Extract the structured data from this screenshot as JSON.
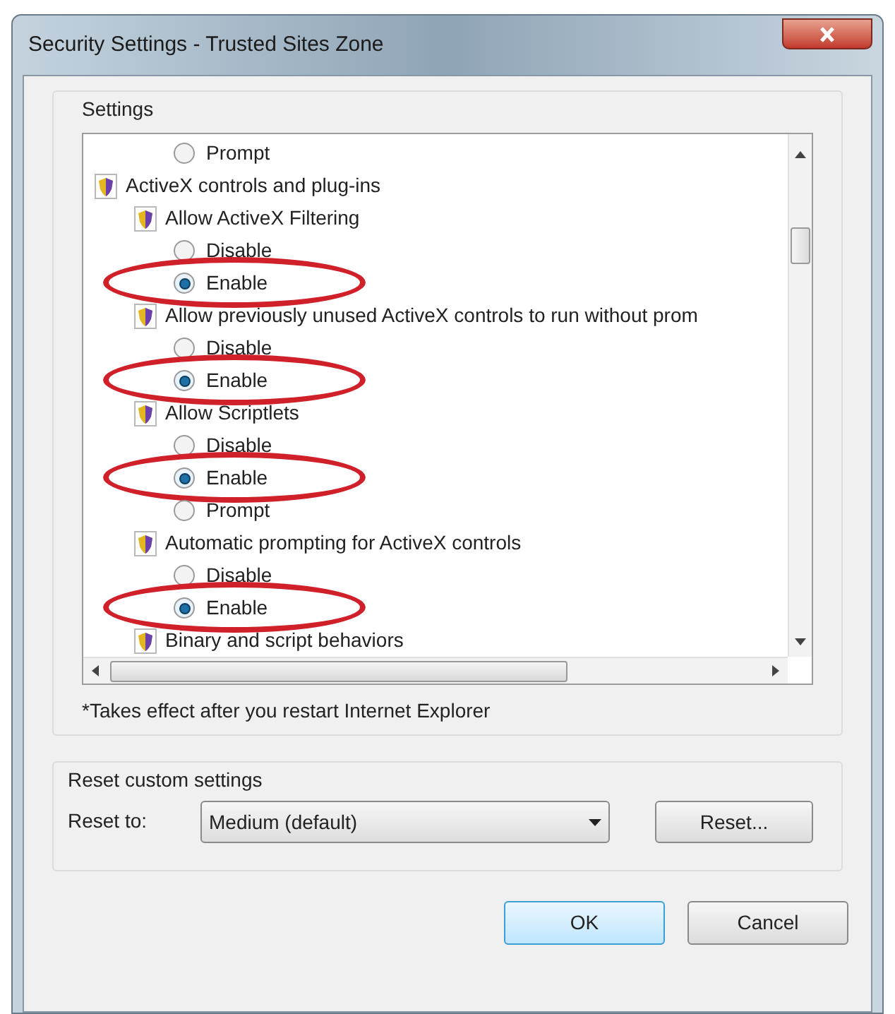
{
  "window": {
    "title": "Security Settings - Trusted Sites Zone"
  },
  "settings": {
    "label": "Settings",
    "items": [
      {
        "kind": "option",
        "label": "Prompt",
        "selected": false,
        "highlighted": false
      },
      {
        "kind": "category",
        "label": "ActiveX controls and plug-ins",
        "children": [
          {
            "kind": "setting",
            "label": "Allow ActiveX Filtering",
            "children": [
              {
                "kind": "option",
                "label": "Disable",
                "selected": false,
                "highlighted": false
              },
              {
                "kind": "option",
                "label": "Enable",
                "selected": true,
                "highlighted": true
              }
            ]
          },
          {
            "kind": "setting",
            "label": "Allow previously unused ActiveX controls to run without prom",
            "children": [
              {
                "kind": "option",
                "label": "Disable",
                "selected": false,
                "highlighted": false
              },
              {
                "kind": "option",
                "label": "Enable",
                "selected": true,
                "highlighted": true
              }
            ]
          },
          {
            "kind": "setting",
            "label": "Allow Scriptlets",
            "children": [
              {
                "kind": "option",
                "label": "Disable",
                "selected": false,
                "highlighted": false
              },
              {
                "kind": "option",
                "label": "Enable",
                "selected": true,
                "highlighted": true
              },
              {
                "kind": "option",
                "label": "Prompt",
                "selected": false,
                "highlighted": false
              }
            ]
          },
          {
            "kind": "setting",
            "label": "Automatic prompting for ActiveX controls",
            "children": [
              {
                "kind": "option",
                "label": "Disable",
                "selected": false,
                "highlighted": false
              },
              {
                "kind": "option",
                "label": "Enable",
                "selected": true,
                "highlighted": true
              }
            ]
          },
          {
            "kind": "setting",
            "label": "Binary and script behaviors"
          }
        ]
      }
    ],
    "note": "*Takes effect after you restart Internet Explorer"
  },
  "reset": {
    "label": "Reset custom settings",
    "field_label": "Reset to:",
    "value": "Medium (default)",
    "button": "Reset..."
  },
  "buttons": [
    {
      "label": "OK",
      "default": true
    },
    {
      "label": "Cancel",
      "default": false
    }
  ]
}
